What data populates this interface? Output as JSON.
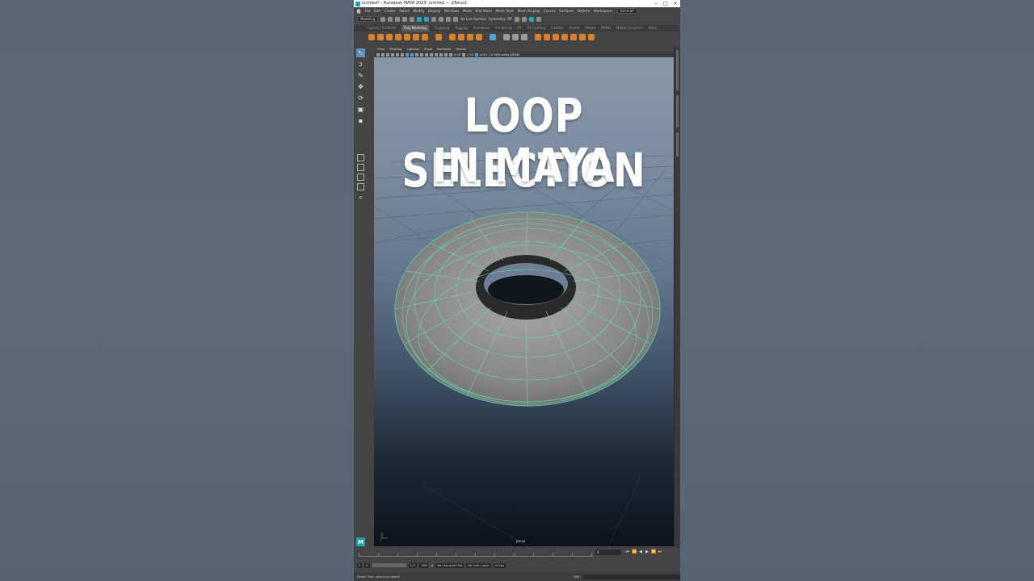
{
  "window": {
    "title": "untitled* - Autodesk MAYA 2023: untitled  ---  pTorus1",
    "controls": [
      "–",
      "□",
      "✕"
    ]
  },
  "menu": [
    "File",
    "Edit",
    "Create",
    "Select",
    "Modify",
    "Display",
    "Windows",
    "Mesh",
    "Edit Mesh",
    "Mesh Tools",
    "Mesh Display",
    "Curves",
    "Surfaces",
    "Deform",
    "Workspace:",
    "General*"
  ],
  "status_line": {
    "mode_dropdown": "Modeling",
    "live_surface": "No Live Surface",
    "symmetry": "Symmetry: Off"
  },
  "shelf_tabs": [
    "Curves / Surfaces",
    "Poly Modeling",
    "Sculpting",
    "Rigging",
    "Animation",
    "Rendering",
    "FX",
    "FX Caching",
    "Custom",
    "Arnold",
    "Bifrost",
    "MASH",
    "Motion Graphics",
    "XGen"
  ],
  "shelf_tabs_active": 1,
  "panel_menu": [
    "View",
    "Shading",
    "Lighting",
    "Show",
    "Renderer",
    "Panels"
  ],
  "panel_toolbar": {
    "value_a": "0.00",
    "value_b": "1.00",
    "colorspace": "ACES 1.0 SDR-video (sRGB)"
  },
  "viewport": {
    "overlay_title_line1": "LOOP SELECTION",
    "overlay_title_line2": "IN MAYA",
    "camera_label": "persp"
  },
  "timeline": {
    "current_frame": "0",
    "start": "0",
    "end": "120"
  },
  "range": {
    "start": "0",
    "inner_start": "0",
    "range_start": "1",
    "range_end": "120",
    "inner_end": "117",
    "end": "200",
    "character_set": "No Character Set",
    "anim_layer": "No Anim Layer",
    "fps": "24 fps"
  },
  "help_line": {
    "text": "Select Tool: select an object",
    "mel_label": "MEL"
  }
}
